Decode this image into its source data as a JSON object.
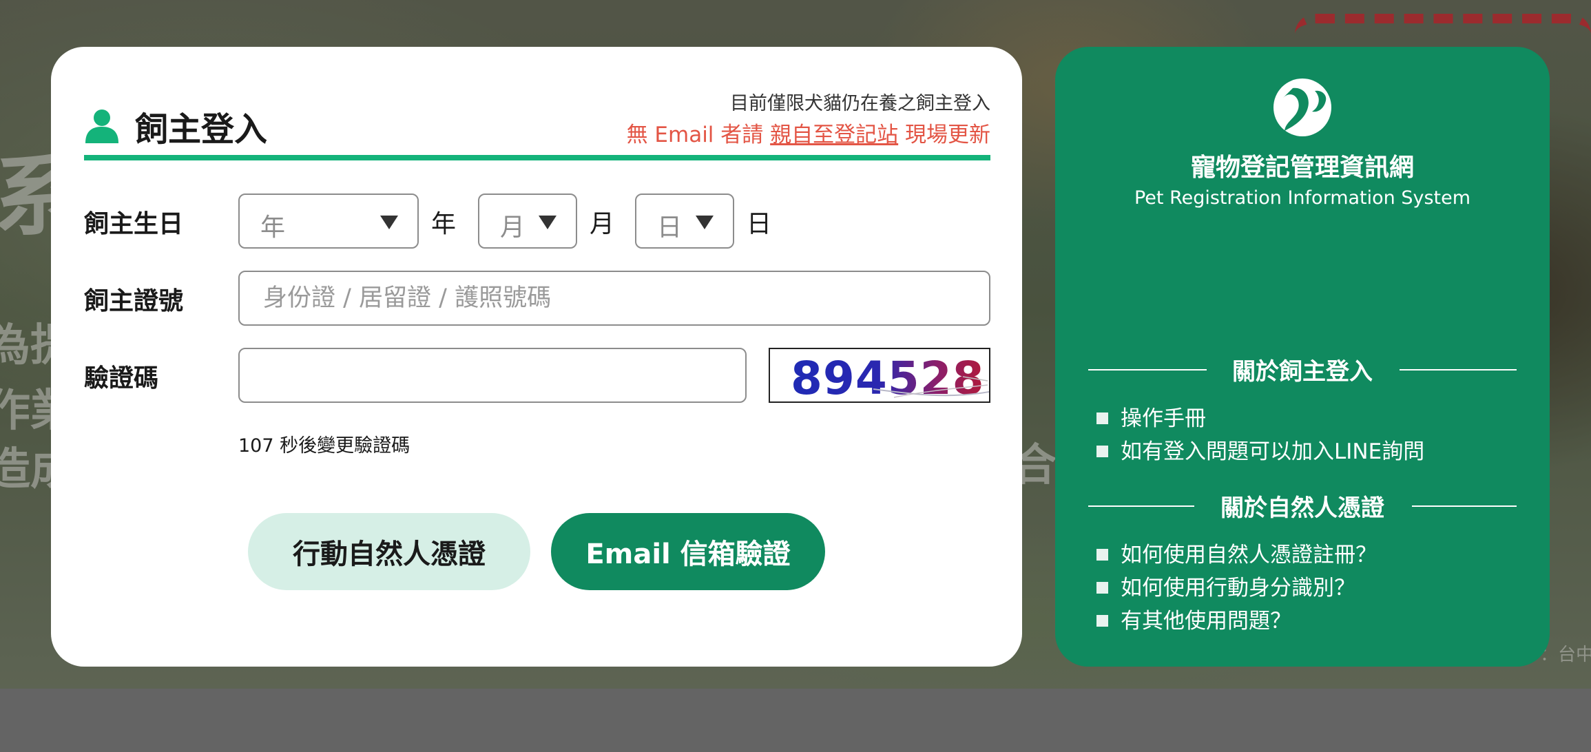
{
  "background": {
    "text_lines": [
      "系",
      "為提",
      "作業",
      "造成",
      "合",
      "：台中"
    ]
  },
  "login": {
    "title": "飼主登入",
    "notice_line1": "目前僅限犬貓仍在養之飼主登入",
    "notice_line2_prefix": "無 Email 者請",
    "notice_line2_link": "親自至登記站",
    "notice_line2_suffix": "現場更新",
    "accent_color": "#14b37a",
    "birthday": {
      "label": "飼主生日",
      "year_placeholder": "年",
      "year_unit": "年",
      "month_placeholder": "月",
      "month_unit": "月",
      "day_placeholder": "日",
      "day_unit": "日"
    },
    "id_field": {
      "label": "飼主證號",
      "placeholder": "身份證 / 居留證 / 護照號碼"
    },
    "captcha": {
      "label": "驗證碼",
      "value": "",
      "image_text": "894528",
      "countdown": "107 秒後變更驗證碼"
    },
    "buttons": {
      "natural_person": "行動自然人憑證",
      "email": "Email 信箱驗證"
    }
  },
  "info_panel": {
    "bg_color": "#108a5f",
    "logo_icon": "paw-logo-icon",
    "system_name": "寵物登記管理資訊網",
    "system_name_en": "Pet Registration Information System",
    "sections": [
      {
        "title": "關於飼主登入",
        "items": [
          "操作手冊",
          "如有登入問題可以加入LINE詢問"
        ]
      },
      {
        "title": "關於自然人憑證",
        "items": [
          "如何使用自然人憑證註冊？",
          "如何使用行動身分識別？",
          "有其他使用問題？"
        ]
      }
    ]
  }
}
